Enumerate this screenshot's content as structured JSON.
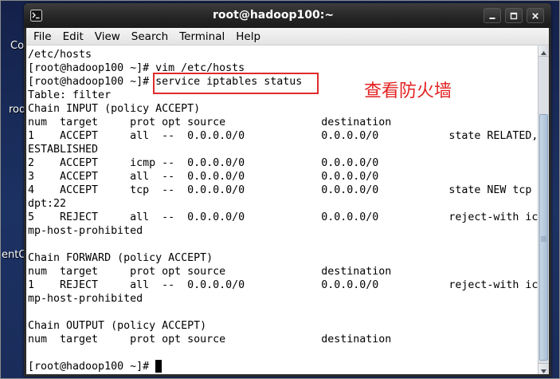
{
  "desktop": {
    "icon_labels": [
      "Co",
      "roo",
      "entO"
    ]
  },
  "window": {
    "title": "root@hadoop100:~",
    "icon": "terminal-icon",
    "controls": [
      "minimize-icon",
      "maximize-icon",
      "close-icon"
    ]
  },
  "menu": {
    "items": [
      "File",
      "Edit",
      "View",
      "Search",
      "Terminal",
      "Help"
    ]
  },
  "terminal": {
    "history": [
      "/etc/hosts",
      "[root@hadoop100 ~]# vim /etc/hosts"
    ],
    "highlighted_line": {
      "prompt": "[root@hadoop100 ~]# ",
      "command": "service iptables status"
    },
    "output": [
      "Table: filter",
      "Chain INPUT (policy ACCEPT)",
      "num  target     prot opt source               destination",
      "1    ACCEPT     all  --  0.0.0.0/0            0.0.0.0/0           state RELATED,",
      "ESTABLISHED",
      "2    ACCEPT     icmp --  0.0.0.0/0            0.0.0.0/0",
      "3    ACCEPT     all  --  0.0.0.0/0            0.0.0.0/0",
      "4    ACCEPT     tcp  --  0.0.0.0/0            0.0.0.0/0           state NEW tcp",
      "dpt:22",
      "5    REJECT     all  --  0.0.0.0/0            0.0.0.0/0           reject-with ic",
      "mp-host-prohibited",
      "",
      "Chain FORWARD (policy ACCEPT)",
      "num  target     prot opt source               destination",
      "1    REJECT     all  --  0.0.0.0/0            0.0.0.0/0           reject-with ic",
      "mp-host-prohibited",
      "",
      "Chain OUTPUT (policy ACCEPT)",
      "num  target     prot opt source               destination",
      ""
    ],
    "current_prompt": "[root@hadoop100 ~]# "
  },
  "annotation": {
    "text": "查看防火墙",
    "color": "#e32222",
    "box_color": "#e02b2b"
  },
  "colors": {
    "terminal_background": "#ffffff",
    "terminal_foreground": "#000000"
  }
}
